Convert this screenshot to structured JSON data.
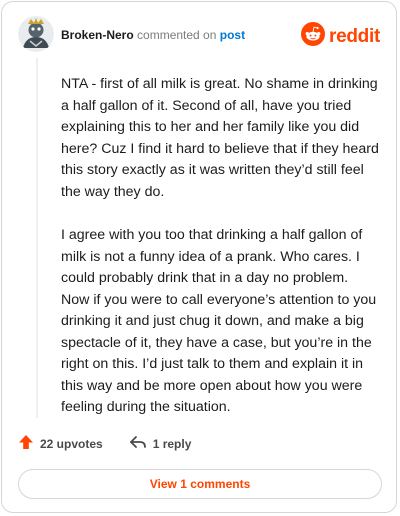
{
  "comment": {
    "username": "Broken-Nero",
    "commented_on_text": "commented on",
    "post_link": "post",
    "paragraphs": [
      "NTA - first of all milk is great. No shame in drinking a half gallon of it. Second of all, have you tried explaining this to her and her family like you did here? Cuz I find it hard to believe that if they heard this story exactly as it was written they’d still feel the way they do.",
      "I agree with you too that drinking a half gallon of milk is not a funny idea of a prank. Who cares. I could probably drink that in a day no problem. Now if you were to call everyone’s attention to you drinking it and just chug it down, and make a big spectacle of it, they have a case, but you’re in the right on this. I’d just talk to them and explain it in this way and be more open about how you were feeling during the situation."
    ]
  },
  "brand": {
    "wordmark": "reddit",
    "color": "#ff4500"
  },
  "actions": {
    "upvotes_label": "22 upvotes",
    "reply_label": "1 reply"
  },
  "view_button_label": "View 1 comments",
  "icons": {
    "avatar": "user-avatar",
    "brand": "reddit-snoo-icon",
    "upvote": "upvote-arrow-icon",
    "reply": "reply-arrow-icon"
  },
  "colors": {
    "link": "#0079d3",
    "accent": "#ff4500",
    "muted": "#7c7c7c",
    "border": "#d6d6d6"
  }
}
